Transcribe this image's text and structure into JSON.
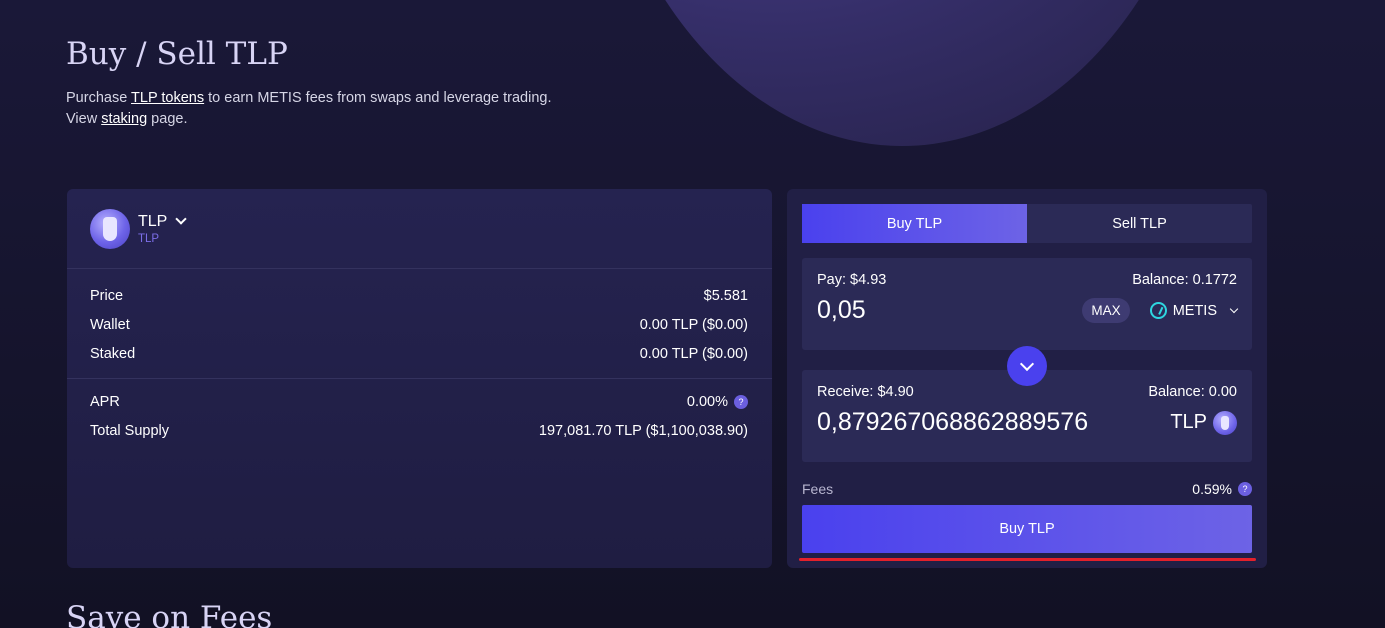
{
  "header": {
    "title": "Buy / Sell TLP",
    "line1_prefix": "Purchase ",
    "line1_link": "TLP tokens",
    "line1_suffix": " to earn METIS fees from swaps and leverage trading.",
    "line2_prefix": "View ",
    "line2_link": "staking",
    "line2_suffix": " page."
  },
  "token_card": {
    "name": "TLP",
    "sub": "TLP",
    "price_label": "Price",
    "price_value": "$5.581",
    "wallet_label": "Wallet",
    "wallet_value": "0.00 TLP ($0.00)",
    "staked_label": "Staked",
    "staked_value": "0.00 TLP ($0.00)",
    "apr_label": "APR",
    "apr_value": "0.00%",
    "supply_label": "Total Supply",
    "supply_value": "197,081.70 TLP ($1,100,038.90)"
  },
  "swap": {
    "tab_buy": "Buy TLP",
    "tab_sell": "Sell TLP",
    "pay_label": "Pay: $4.93",
    "pay_balance": "Balance: 0.1772",
    "pay_amount": "0,05",
    "max_label": "MAX",
    "pay_token": "METIS",
    "receive_label": "Receive: $4.90",
    "receive_balance": "Balance: 0.00",
    "receive_amount": "0,879267068862889576",
    "receive_token": "TLP",
    "fees_label": "Fees",
    "fees_value": "0.59%",
    "submit_label": "Buy TLP",
    "help_glyph": "?"
  },
  "next_section": {
    "title": "Save on Fees"
  },
  "colors": {
    "accent": "#4a41ee",
    "highlight_underline": "#e3212b"
  }
}
